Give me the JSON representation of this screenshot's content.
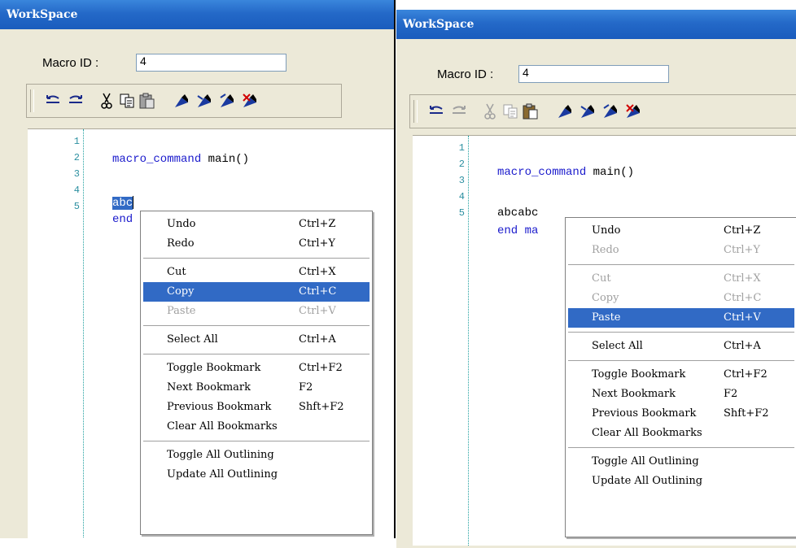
{
  "left": {
    "title": "WorkSpace",
    "macro_label": "Macro ID :",
    "macro_id": "4",
    "line_numbers": [
      "1",
      "2",
      "3",
      "4",
      "5"
    ],
    "line2_kw": "macro_command",
    "line2_rest": " main()",
    "line4_selected": "abc",
    "line5": "end",
    "menu": {
      "undo": "Undo",
      "undo_sc": "Ctrl+Z",
      "redo": "Redo",
      "redo_sc": "Ctrl+Y",
      "cut": "Cut",
      "cut_sc": "Ctrl+X",
      "copy": "Copy",
      "copy_sc": "Ctrl+C",
      "paste": "Paste",
      "paste_sc": "Ctrl+V",
      "select_all": "Select All",
      "select_all_sc": "Ctrl+A",
      "toggle_bookmark": "Toggle Bookmark",
      "toggle_bookmark_sc": "Ctrl+F2",
      "next_bookmark": "Next Bookmark",
      "next_bookmark_sc": "F2",
      "prev_bookmark": "Previous Bookmark",
      "prev_bookmark_sc": "Shft+F2",
      "clear_bookmarks": "Clear All Bookmarks",
      "toggle_outlining": "Toggle All Outlining",
      "update_outlining": "Update All Outlining"
    }
  },
  "right": {
    "title": "WorkSpace",
    "macro_label": "Macro ID :",
    "macro_id": "4",
    "line_numbers": [
      "1",
      "2",
      "3",
      "4",
      "5"
    ],
    "line2_kw": "macro_command",
    "line2_rest": " main()",
    "line4": "abcabc",
    "line5": "end ma",
    "menu": {
      "undo": "Undo",
      "undo_sc": "Ctrl+Z",
      "redo": "Redo",
      "redo_sc": "Ctrl+Y",
      "cut": "Cut",
      "cut_sc": "Ctrl+X",
      "copy": "Copy",
      "copy_sc": "Ctrl+C",
      "paste": "Paste",
      "paste_sc": "Ctrl+V",
      "select_all": "Select All",
      "select_all_sc": "Ctrl+A",
      "toggle_bookmark": "Toggle Bookmark",
      "toggle_bookmark_sc": "Ctrl+F2",
      "next_bookmark": "Next Bookmark",
      "next_bookmark_sc": "F2",
      "prev_bookmark": "Previous Bookmark",
      "prev_bookmark_sc": "Shft+F2",
      "clear_bookmarks": "Clear All Bookmarks",
      "toggle_outlining": "Toggle All Outlining",
      "update_outlining": "Update All Outlining"
    }
  },
  "colors": {
    "title_blue": "#2469c8",
    "selection": "#316ac5",
    "line_numbers": "#2b8fa0",
    "keyword": "#1a1acc"
  },
  "icons": [
    "undo-icon",
    "redo-icon",
    "cut-icon",
    "copy-icon",
    "paste-icon",
    "toggle-bookmark-icon",
    "next-bookmark-icon",
    "prev-bookmark-icon",
    "clear-bookmarks-icon"
  ]
}
